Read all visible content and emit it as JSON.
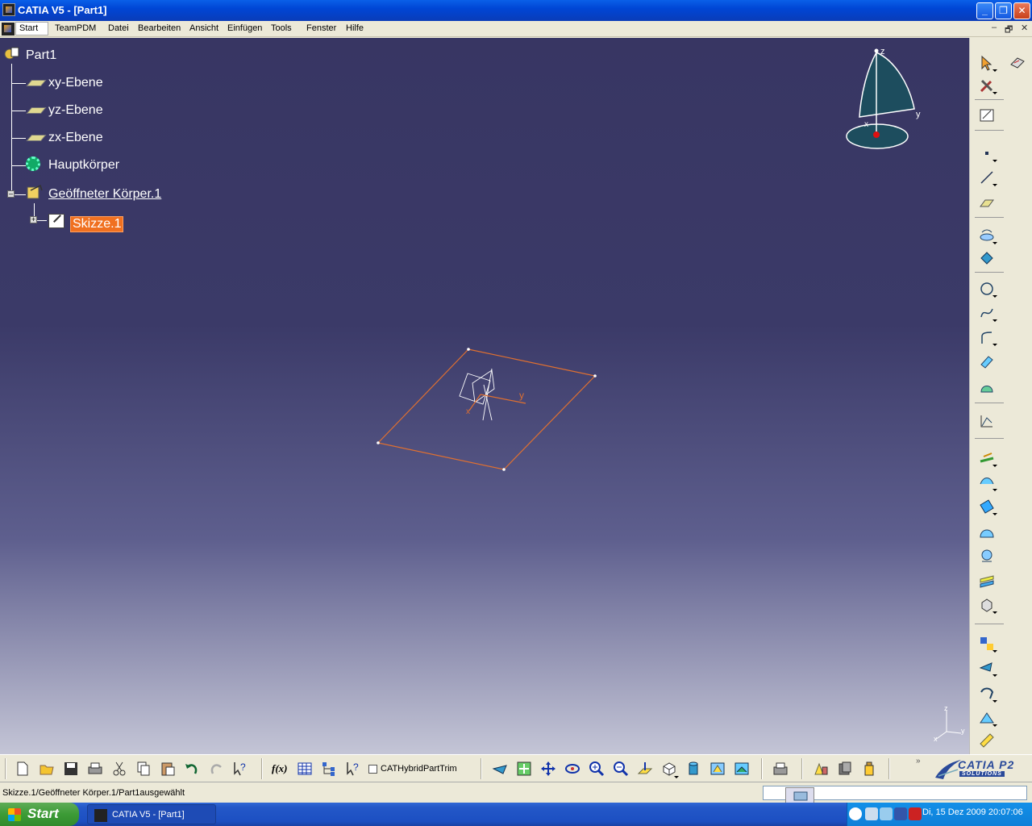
{
  "window": {
    "title": "CATIA V5 - [Part1]",
    "min": "_",
    "max": "❐",
    "close": "✕"
  },
  "menu": {
    "items": [
      "Start",
      "TeamPDM",
      "Datei",
      "Bearbeiten",
      "Ansicht",
      "Einfügen",
      "Tools",
      "Fenster",
      "Hilfe"
    ],
    "doc_controls": [
      "–",
      "🗗",
      "✕"
    ]
  },
  "tree": {
    "root": "Part1",
    "xy": "xy-Ebene",
    "yz": "yz-Ebene",
    "zx": "zx-Ebene",
    "body": "Hauptkörper",
    "open_body": "Geöffneter Körper.1",
    "sketch": "Skizze.1"
  },
  "compass": {
    "x": "x",
    "y": "y",
    "z": "z"
  },
  "axis_small": {
    "y": "y",
    "z": "z",
    "x": "x"
  },
  "sketch_axis": {
    "y": "y",
    "x": "x"
  },
  "toolbar": {
    "formula": "f(x)",
    "checkbox_label": "CATHybridPartTrim"
  },
  "logo": {
    "main": "CATIA P2",
    "sub": "SOLUTIONS"
  },
  "status": {
    "message": "Skizze.1/Geöffneter Körper.1/Part1ausgewählt"
  },
  "taskbar": {
    "start": "Start",
    "task": "CATIA V5 - [Part1]",
    "clock": "Di, 15 Dez 2009   20:07:06"
  },
  "colors": {
    "viewport_top": "#383663",
    "viewport_bottom": "#c4c5d6",
    "selection": "#f07020",
    "sketch_plane": "#e07030"
  }
}
